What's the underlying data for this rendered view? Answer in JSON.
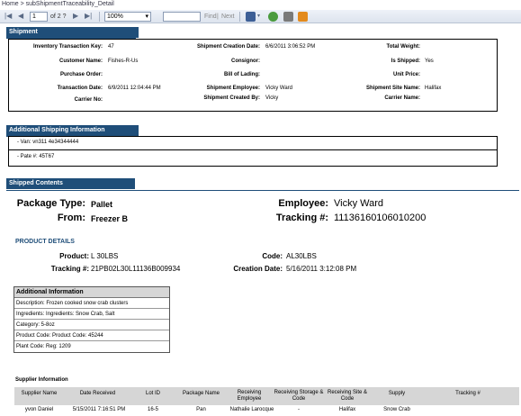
{
  "breadcrumb": "Home > subShipmentTraceability_Detail",
  "toolbar": {
    "page_current": "1",
    "page_of": "of 2 ?",
    "zoom": "100%",
    "find_label": "Find",
    "next_label": "Next",
    "separator": "|"
  },
  "shipment": {
    "section_title": "Shipment",
    "fields": {
      "inventory_key_label": "Inventory Transaction Key:",
      "inventory_key_value": "47",
      "creation_date_label": "Shipment Creation Date:",
      "creation_date_value": "6/6/2011 3:06:52 PM",
      "total_weight_label": "Total Weight:",
      "total_weight_value": "",
      "customer_label": "Customer Name:",
      "customer_value": "Fishes-R-Us",
      "consignor_label": "Consignor:",
      "consignor_value": "",
      "is_shipped_label": "Is Shipped:",
      "is_shipped_value": "Yes",
      "po_label": "Purchase Order:",
      "po_value": "",
      "bol_label": "Bill of Lading:",
      "bol_value": "",
      "unit_price_label": "Unit Price:",
      "unit_price_value": "",
      "txn_date_label": "Transaction Date:",
      "txn_date_value": "6/9/2011 12:04:44 PM",
      "employee_label": "Shipment Employee:",
      "employee_value": "Vicky Ward",
      "site_label": "Shipment Site Name:",
      "site_value": "Halifax",
      "carrier_no_label": "Carrier No:",
      "carrier_no_value": "",
      "created_by_label": "Shipment Created By:",
      "created_by_value": "Vicky",
      "carrier_name_label": "Carrier Name:",
      "carrier_name_value": ""
    }
  },
  "additional_shipping": {
    "section_title": "Additional Shipping Information",
    "rows": [
      "- Van: vn311 4e34344444",
      "- Pate #: 45T67"
    ]
  },
  "shipped_contents": {
    "section_title": "Shipped Contents",
    "package_type_label": "Package Type:",
    "package_type_value": "Pallet",
    "from_label": "From:",
    "from_value": "Freezer B",
    "employee_label": "Employee:",
    "employee_value": "Vicky Ward",
    "tracking_label": "Tracking #:",
    "tracking_value": "11136160106010200"
  },
  "product_details": {
    "title": "PRODUCT DETAILS",
    "product_label": "Product:",
    "product_value": "L 30LBS",
    "code_label": "Code:",
    "code_value": "AL30LBS",
    "tracking_label": "Tracking #:",
    "tracking_value": "21PB02L30L11136B009934",
    "creation_label": "Creation Date:",
    "creation_value": "5/16/2011 3:12:08 PM"
  },
  "additional_info": {
    "title": "Additional Information",
    "rows": [
      "Description: Frozen cooked snow crab clusters",
      "Ingredients: Ingredients: Snow Crab, Salt",
      "Category: 5-8oz",
      "Product Code: Product Code: 45244",
      "Plant Code: Reg: 1209"
    ]
  },
  "supplier": {
    "title": "Supplier Information",
    "headers": [
      "Supplier Name",
      "Date Received",
      "Lot ID",
      "Package Name",
      "Receiving Employee",
      "Receiving Storage & Code",
      "Receiving Site & Code",
      "Supply",
      "Tracking #"
    ],
    "row": [
      "yvon Daniel",
      "5/15/2011 7:16:51 PM",
      "16-5",
      "Pan",
      "Nathalie Larocque",
      "-",
      "Halifax",
      "Snow Crab",
      ""
    ]
  },
  "colors": {
    "section_header": "#1f4e79",
    "table_header": "#d6d6d6",
    "toolbar": "#e3e9f2"
  }
}
